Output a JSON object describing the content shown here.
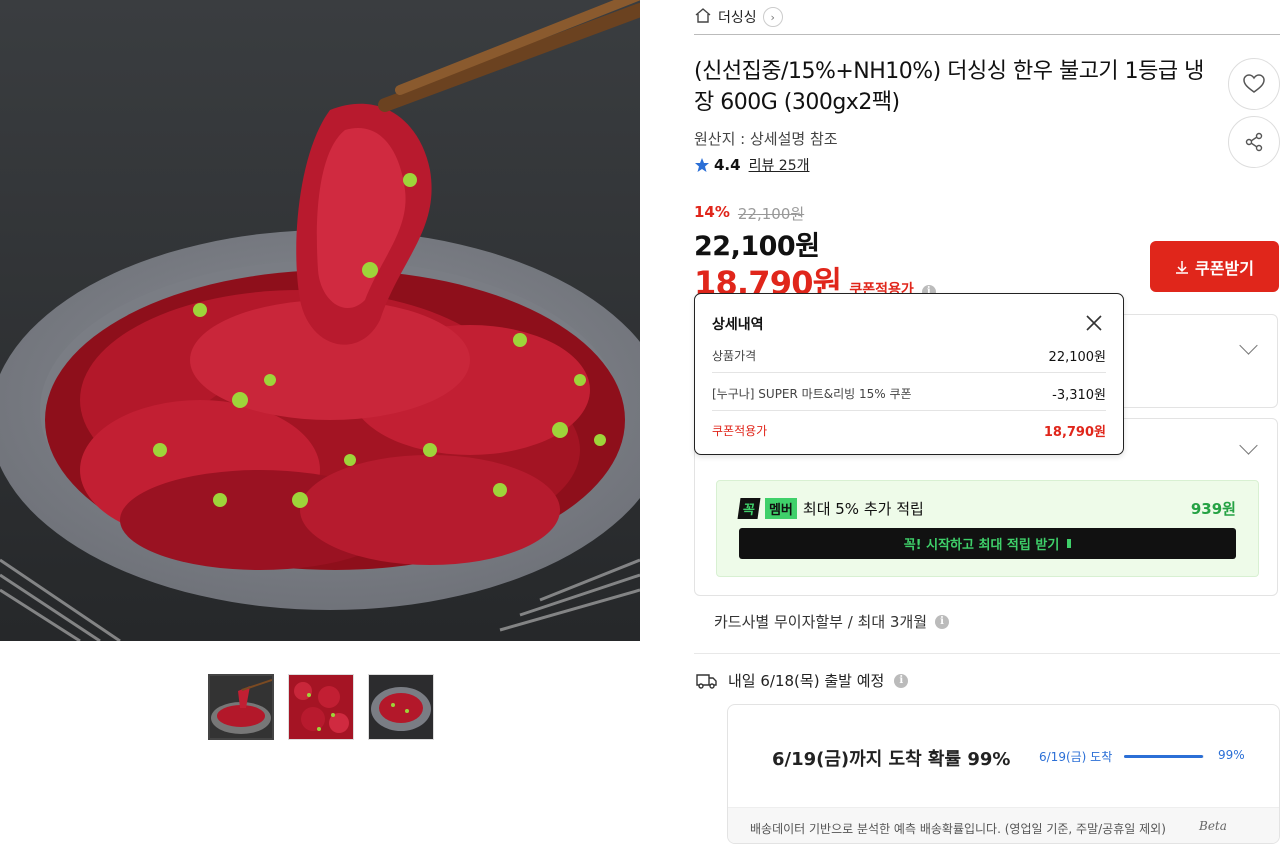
{
  "breadcrumb": {
    "store": "더싱싱",
    "chevron": "›"
  },
  "product": {
    "title": "(신선집중/15%+NH10%) 더싱싱 한우 불고기 1등급 냉장 600G (300gx2팩)",
    "origin": "원산지 : 상세설명 참조",
    "rating": {
      "score": "4.4",
      "reviews": "리뷰 25개"
    }
  },
  "price": {
    "discount_rate": "14%",
    "original": "22,100원",
    "current": "22,100원",
    "coupon_price": "18,790원",
    "coupon_label": "쿠폰적용가"
  },
  "coupon_button": {
    "label": "쿠폰받기"
  },
  "popup": {
    "title": "상세내역",
    "rows": [
      {
        "label": "상품가격",
        "amount": "22,100원"
      },
      {
        "label": "[누구나] SUPER 마트&리빙 15% 쿠폰",
        "amount": "-3,310원"
      },
      {
        "label": "쿠폰적용가",
        "amount": "18,790원"
      }
    ]
  },
  "membership": {
    "badge1": "꼭",
    "badge2": "멤버",
    "text": "최대 5% 추가 적립",
    "points": "939원",
    "cta": "꼭! 시작하고 최대 적립 받기"
  },
  "installment": {
    "text": "카드사별 무이자할부 / 최대 3개월"
  },
  "shipping": {
    "departure": "내일 6/18(목) 출발 예정",
    "arrival_headline": "6/19(금)까지 도착 확률 99%",
    "prob_label": "6/19(금) 도착",
    "prob_value": 0.99,
    "prob_pct": "99%",
    "footer": "배송데이터 기반으로 분석한 예측 배송확률입니다. (영업일 기준, 주말/공휴일 제외)",
    "beta": "Beta"
  },
  "icons": [
    "home-icon",
    "chevron-right-icon",
    "heart-icon",
    "share-icon",
    "star-icon",
    "info-icon",
    "download-icon",
    "close-icon",
    "chevron-down-icon",
    "truck-icon"
  ],
  "colors": {
    "accent_red": "#e0261b",
    "member_green": "#3fd06a",
    "link_blue": "#2b6fd6"
  }
}
